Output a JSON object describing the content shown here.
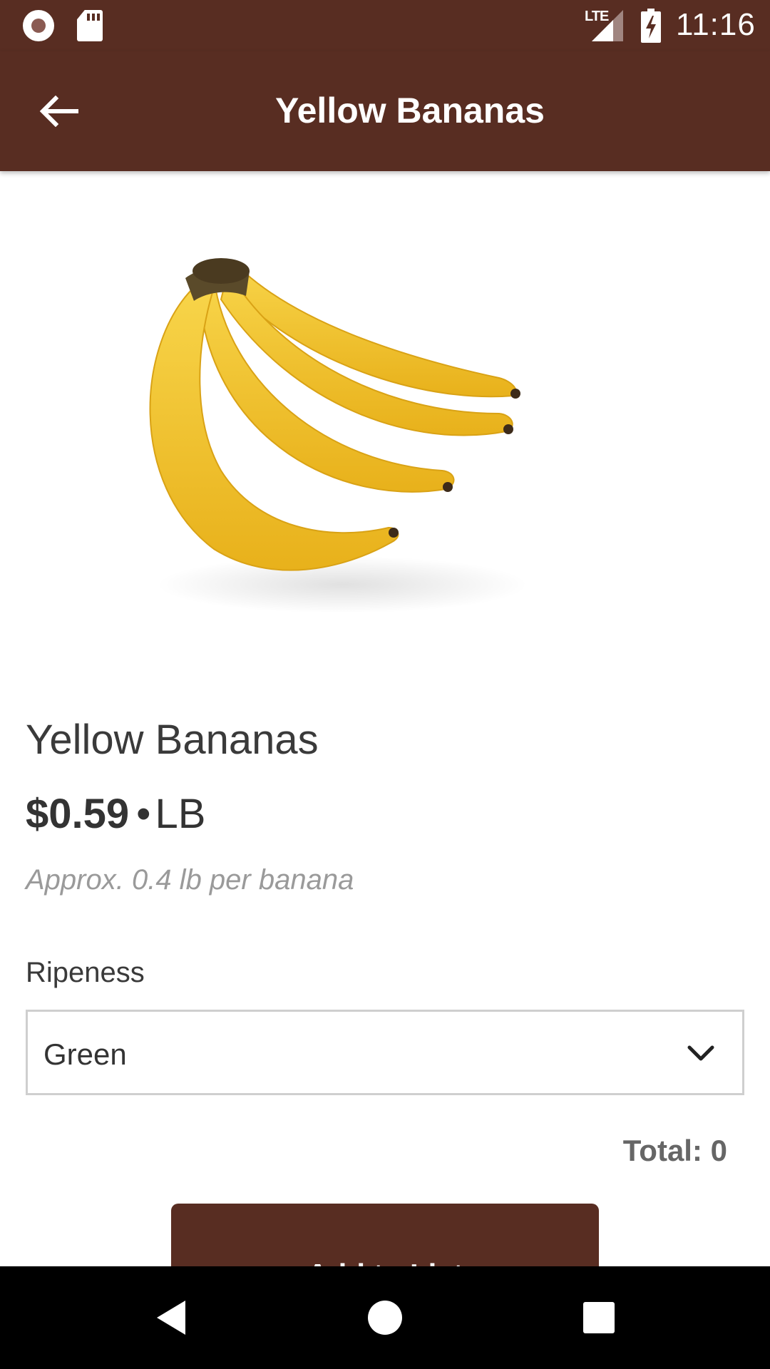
{
  "status_bar": {
    "network": "LTE",
    "time": "11:16"
  },
  "app_bar": {
    "title": "Yellow Bananas",
    "back_icon": "arrow-left-icon"
  },
  "product": {
    "image_icon": "banana-bunch-image",
    "name": "Yellow Bananas",
    "price": "$0.59",
    "separator": "•",
    "unit": "LB",
    "approx_note": "Approx. 0.4 lb per banana"
  },
  "ripeness": {
    "label": "Ripeness",
    "selected": "Green",
    "chevron_icon": "chevron-down-icon"
  },
  "total_text": "Total: 0",
  "add_button_label": "Add to List",
  "colors": {
    "brand": "#582d22",
    "banana": "#f5c52a",
    "muted_text": "#9a9a9a"
  },
  "nav_bar": {
    "back_icon": "triangle-back-icon",
    "home_icon": "circle-home-icon",
    "recents_icon": "square-recents-icon"
  }
}
